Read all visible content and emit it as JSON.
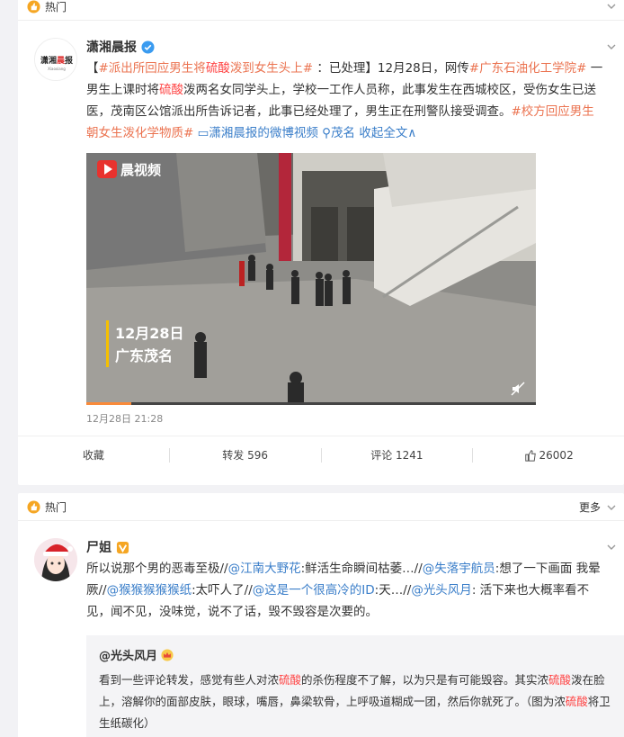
{
  "post1": {
    "hot_label": "热门",
    "username": "潇湘晨报",
    "avatar_text": "潇湘晨报",
    "text_parts": [
      {
        "t": "【",
        "c": ""
      },
      {
        "t": "#派出所回应男生将",
        "c": "link"
      },
      {
        "t": "硫酸",
        "c": "red"
      },
      {
        "t": "泼到女生头上#",
        "c": "link"
      },
      {
        "t": " ：已处理】12月28日，网传",
        "c": ""
      },
      {
        "t": "#广东石油化工学院#",
        "c": "link"
      },
      {
        "t": " 一男生上课时将",
        "c": ""
      },
      {
        "t": "硫酸",
        "c": "red"
      },
      {
        "t": "泼两名女同学头上，学校一工作人员称，此事发生在西城校区，受伤女生已送医，茂南区公馆派出所告诉记者，此事已经处理了，男生正在刑警队接受调查。",
        "c": ""
      },
      {
        "t": "#校方回应男生朝女生泼化学物质#",
        "c": "link"
      },
      {
        "t": " ",
        "c": ""
      },
      {
        "t": "▭潇湘晨报的微博视频",
        "c": "blue"
      },
      {
        "t": " ",
        "c": ""
      },
      {
        "t": "⚲茂名",
        "c": "blue"
      },
      {
        "t": " ",
        "c": ""
      },
      {
        "t": "收起全文∧",
        "c": "blue"
      }
    ],
    "video": {
      "logo": "晨视频",
      "date": "12月28日",
      "place": "广东茂名"
    },
    "timestamp": "12月28日 21:28",
    "actions": {
      "collect": "收藏",
      "repost": "转发 596",
      "comment": "评论 1241",
      "like": "26002"
    }
  },
  "post2": {
    "hot_label": "热门",
    "more_label": "更多",
    "username": "尸姐",
    "text_parts": [
      {
        "t": "所以说那个男的恶毒至极//",
        "c": ""
      },
      {
        "t": "@江南大野花",
        "c": "blue"
      },
      {
        "t": ":鲜活生命瞬间枯萎…//",
        "c": ""
      },
      {
        "t": "@失落宇航员",
        "c": "blue"
      },
      {
        "t": ":想了一下画面 我晕厥//",
        "c": ""
      },
      {
        "t": "@猴猴猴猴猴纸",
        "c": "blue"
      },
      {
        "t": ":太吓人了//",
        "c": ""
      },
      {
        "t": "@这是一个很高冷的ID",
        "c": "blue"
      },
      {
        "t": ":天…//",
        "c": ""
      },
      {
        "t": "@光头风月",
        "c": "blue"
      },
      {
        "t": ": 活下来也大概率看不见，闻不见，没味觉，说不了话，毁不毁容是次要的。",
        "c": ""
      }
    ],
    "quote": {
      "name": "@光头风月",
      "text_parts": [
        {
          "t": "看到一些评论转发，感觉有些人对浓",
          "c": ""
        },
        {
          "t": "硫酸",
          "c": "red"
        },
        {
          "t": "的杀伤程度不了解，以为只是有可能毁容。其实浓",
          "c": ""
        },
        {
          "t": "硫酸",
          "c": "red"
        },
        {
          "t": "泼在脸上，溶解你的面部皮肤，眼球，嘴唇，鼻梁软骨，上呼吸道糊成一团，然后你就死了。（图为浓",
          "c": ""
        },
        {
          "t": "硫酸",
          "c": "red"
        },
        {
          "t": "将卫生纸碳化）",
          "c": ""
        }
      ]
    }
  }
}
